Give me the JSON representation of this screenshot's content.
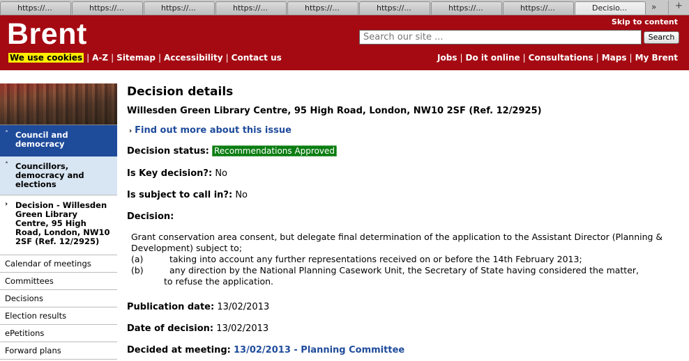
{
  "browser": {
    "tabs": [
      {
        "label": "https://..."
      },
      {
        "label": "https://..."
      },
      {
        "label": "https://..."
      },
      {
        "label": "https://..."
      },
      {
        "label": "https://..."
      },
      {
        "label": "https://..."
      },
      {
        "label": "https://..."
      },
      {
        "label": "https://..."
      },
      {
        "label": "Decisio..."
      }
    ],
    "more_label": "»",
    "new_tab_label": "+"
  },
  "header": {
    "logo": "Brent",
    "skip_link": "Skip to content",
    "search_placeholder": "Search our site ...",
    "search_button": "Search",
    "left_nav": {
      "cookies": "We use cookies",
      "items": [
        "A-Z",
        "Sitemap",
        "Accessibility",
        "Contact us"
      ]
    },
    "right_nav": [
      "Jobs",
      "Do it online",
      "Consultations",
      "Maps",
      "My Brent"
    ],
    "separator": "|"
  },
  "sidebar": {
    "current": "Council and democracy",
    "sub": "Councillors, democracy and elections",
    "leaf": "Decision - Willesden Green Library Centre, 95 High Road, London, NW10 2SF (Ref. 12/2925)",
    "items": [
      "Calendar of meetings",
      "Committees",
      "Decisions",
      "Election results",
      "ePetitions",
      "Forward plans"
    ]
  },
  "main": {
    "title": "Decision details",
    "subtitle": "Willesden Green Library Centre, 95 High Road, London, NW10 2SF (Ref. 12/2925)",
    "find_out_more": "Find out more about this issue",
    "status_label": "Decision status:",
    "status_value": "Recommendations Approved",
    "key_label": "Is Key decision?:",
    "key_value": "No",
    "callin_label": "Is subject to call in?:",
    "callin_value": "No",
    "decision_label": "Decision:",
    "decision_intro": "Grant conservation area consent, but delegate final determination of the application to the Assistant Director (Planning & Development) subject to;",
    "decision_items": [
      {
        "mark": "(a)",
        "text": "taking into account any further representations received on or before the 14th February 2013;"
      },
      {
        "mark": "(b)",
        "text": "any direction by the National Planning Casework Unit, the Secretary of State having considered the matter,"
      }
    ],
    "decision_tail": "to refuse the application.",
    "publication_label": "Publication date:",
    "publication_value": "13/02/2013",
    "date_label": "Date of decision:",
    "date_value": "13/02/2013",
    "meeting_label": "Decided at meeting:",
    "meeting_value": "13/02/2013 - Planning Committee"
  },
  "colors": {
    "brand_red": "#a50a12",
    "nav_blue": "#1f4b9b",
    "status_green": "#0b7d12",
    "cookie_yellow": "#ffee00"
  }
}
